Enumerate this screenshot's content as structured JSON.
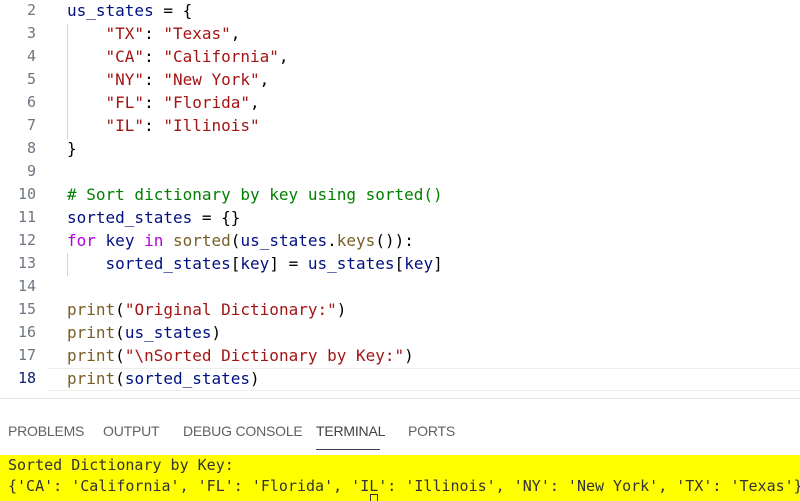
{
  "editor": {
    "lines": [
      {
        "n": "2",
        "t": [
          [
            "v",
            "us_states"
          ],
          [
            "d",
            " = {"
          ]
        ]
      },
      {
        "n": "3",
        "t": [
          [
            "d",
            "    "
          ],
          [
            "s",
            "\"TX\""
          ],
          [
            "d",
            ": "
          ],
          [
            "s",
            "\"Texas\""
          ],
          [
            "d",
            ","
          ]
        ]
      },
      {
        "n": "4",
        "t": [
          [
            "d",
            "    "
          ],
          [
            "s",
            "\"CA\""
          ],
          [
            "d",
            ": "
          ],
          [
            "s",
            "\"California\""
          ],
          [
            "d",
            ","
          ]
        ]
      },
      {
        "n": "5",
        "t": [
          [
            "d",
            "    "
          ],
          [
            "s",
            "\"NY\""
          ],
          [
            "d",
            ": "
          ],
          [
            "s",
            "\"New York\""
          ],
          [
            "d",
            ","
          ]
        ]
      },
      {
        "n": "6",
        "t": [
          [
            "d",
            "    "
          ],
          [
            "s",
            "\"FL\""
          ],
          [
            "d",
            ": "
          ],
          [
            "s",
            "\"Florida\""
          ],
          [
            "d",
            ","
          ]
        ]
      },
      {
        "n": "7",
        "t": [
          [
            "d",
            "    "
          ],
          [
            "s",
            "\"IL\""
          ],
          [
            "d",
            ": "
          ],
          [
            "s",
            "\"Illinois\""
          ]
        ]
      },
      {
        "n": "8",
        "t": [
          [
            "d",
            "}"
          ]
        ]
      },
      {
        "n": "9",
        "t": []
      },
      {
        "n": "10",
        "t": [
          [
            "c",
            "# Sort dictionary by key using sorted()"
          ]
        ]
      },
      {
        "n": "11",
        "t": [
          [
            "v",
            "sorted_states"
          ],
          [
            "d",
            " = {}"
          ]
        ]
      },
      {
        "n": "12",
        "t": [
          [
            "k",
            "for"
          ],
          [
            "d",
            " "
          ],
          [
            "v",
            "key"
          ],
          [
            "d",
            " "
          ],
          [
            "k",
            "in"
          ],
          [
            "d",
            " "
          ],
          [
            "f",
            "sorted"
          ],
          [
            "p",
            "("
          ],
          [
            "v",
            "us_states"
          ],
          [
            "d",
            "."
          ],
          [
            "f",
            "keys"
          ],
          [
            "p",
            "()"
          ],
          [
            "d",
            "):"
          ]
        ]
      },
      {
        "n": "13",
        "t": [
          [
            "d",
            "    "
          ],
          [
            "v",
            "sorted_states"
          ],
          [
            "d",
            "["
          ],
          [
            "v",
            "key"
          ],
          [
            "d",
            "] = "
          ],
          [
            "v",
            "us_states"
          ],
          [
            "d",
            "["
          ],
          [
            "v",
            "key"
          ],
          [
            "d",
            "]"
          ]
        ]
      },
      {
        "n": "14",
        "t": []
      },
      {
        "n": "15",
        "t": [
          [
            "f",
            "print"
          ],
          [
            "d",
            "("
          ],
          [
            "s",
            "\"Original Dictionary:\""
          ],
          [
            "d",
            ")"
          ]
        ]
      },
      {
        "n": "16",
        "t": [
          [
            "f",
            "print"
          ],
          [
            "d",
            "("
          ],
          [
            "v",
            "us_states"
          ],
          [
            "d",
            ")"
          ]
        ]
      },
      {
        "n": "17",
        "t": [
          [
            "f",
            "print"
          ],
          [
            "d",
            "("
          ],
          [
            "s",
            "\"\\nSorted Dictionary by Key:\""
          ],
          [
            "d",
            ")"
          ]
        ]
      },
      {
        "n": "18",
        "t": [
          [
            "f",
            "print"
          ],
          [
            "d",
            "("
          ],
          [
            "v",
            "sorted_states"
          ],
          [
            "d",
            ")"
          ]
        ]
      }
    ],
    "active_line": "18"
  },
  "panel": {
    "tabs": [
      "PROBLEMS",
      "OUTPUT",
      "DEBUG CONSOLE",
      "TERMINAL",
      "PORTS"
    ],
    "active_tab": "TERMINAL"
  },
  "terminal": {
    "line1": "Sorted Dictionary by Key:",
    "line2": "{'CA': 'California', 'FL': 'Florida', 'IL': 'Illinois', 'NY': 'New York', 'TX': 'Texas'}",
    "highlight_color": "#ffff00"
  },
  "colors": {
    "variable": "#001080",
    "string": "#a31515",
    "function": "#795e26",
    "keyword": "#af00db",
    "comment": "#008000"
  }
}
